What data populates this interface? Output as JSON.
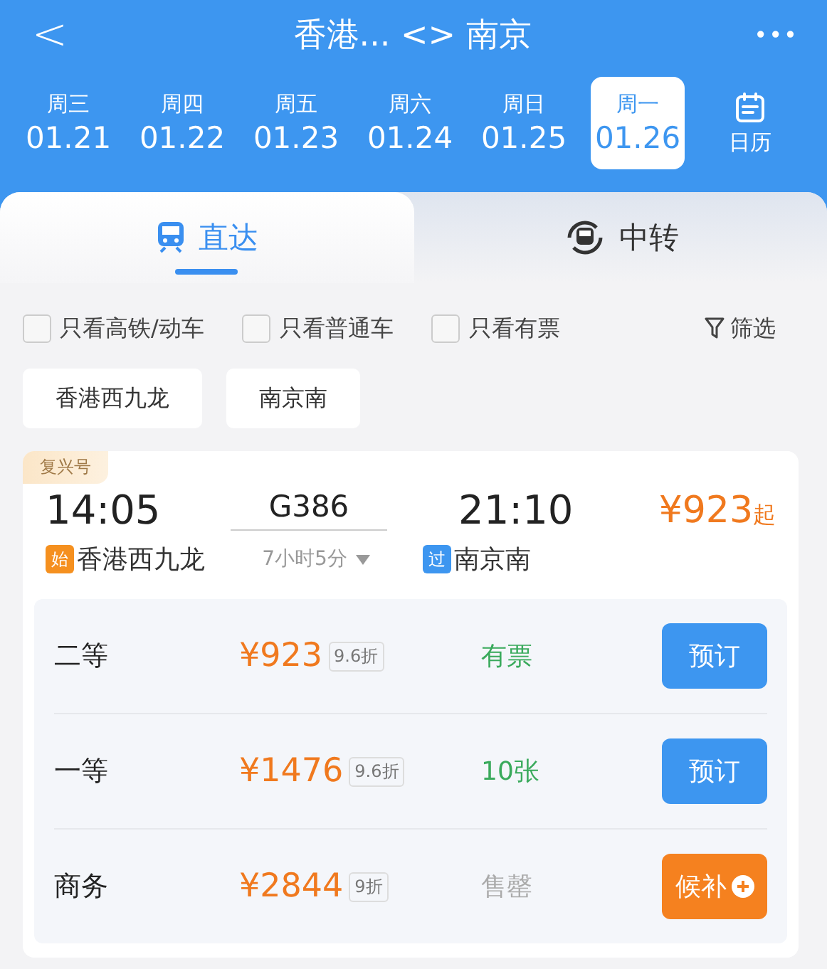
{
  "header": {
    "back": "<",
    "title": "香港... <> 南京",
    "more": "•••"
  },
  "dates": [
    {
      "weekday": "周三",
      "date": "01.21",
      "selected": false
    },
    {
      "weekday": "周四",
      "date": "01.22",
      "selected": false
    },
    {
      "weekday": "周五",
      "date": "01.23",
      "selected": false
    },
    {
      "weekday": "周六",
      "date": "01.24",
      "selected": false
    },
    {
      "weekday": "周日",
      "date": "01.25",
      "selected": false
    },
    {
      "weekday": "周一",
      "date": "01.26",
      "selected": true
    }
  ],
  "calendar": {
    "label": "日历"
  },
  "tabs": [
    {
      "label": "直达",
      "kind": "direct",
      "selected": true
    },
    {
      "label": "中转",
      "kind": "transfer",
      "selected": false
    }
  ],
  "filters": [
    {
      "label": "只看高铁/动车",
      "checked": false
    },
    {
      "label": "只看普通车",
      "checked": false
    },
    {
      "label": "只看有票",
      "checked": false
    }
  ],
  "filter_button": "筛选",
  "stations": [
    "香港西九龙",
    "南京南"
  ],
  "train": {
    "badge": "复兴号",
    "depart_time": "14:05",
    "number": "G386",
    "arrive_time": "21:10",
    "price": "¥923",
    "price_suffix": "起",
    "from_tag": "始",
    "from_station": "香港西九龙",
    "duration": "7小时5分",
    "to_tag": "过",
    "to_station": "南京南",
    "seats": [
      {
        "class": "二等",
        "price": "¥923",
        "discount": "9.6折",
        "availability": "有票",
        "sold_out": false,
        "action": {
          "label": "预订",
          "kind": "book"
        }
      },
      {
        "class": "一等",
        "price": "¥1476",
        "discount": "9.6折",
        "availability": "10张",
        "sold_out": false,
        "action": {
          "label": "预订",
          "kind": "book"
        }
      },
      {
        "class": "商务",
        "price": "¥2844",
        "discount": "9折",
        "availability": "售罄",
        "sold_out": true,
        "action": {
          "label": "候补",
          "kind": "waitlist"
        }
      }
    ]
  }
}
